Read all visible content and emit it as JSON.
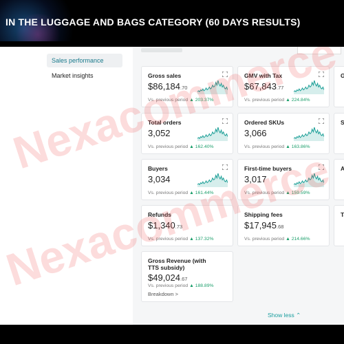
{
  "banner": {
    "title": "IN THE LUGGAGE AND BAGS CATEGORY (60 DAYS RESULTS)"
  },
  "sidebar": {
    "items": [
      {
        "label": "Sales performance",
        "active": true
      },
      {
        "label": "Market insights",
        "active": false
      }
    ]
  },
  "cards": {
    "gross_sales": {
      "title": "Gross sales",
      "value": "$86,184",
      "cents": ".70",
      "vs_label": "Vs. previous period",
      "change": "203.37%"
    },
    "gmv_tax": {
      "title": "GMV with Tax",
      "value": "$67,843",
      "cents": ".77",
      "vs_label": "Vs. previous period",
      "change": "224.84%"
    },
    "total_orders": {
      "title": "Total orders",
      "value": "3,052",
      "vs_label": "Vs. previous period",
      "change": "162.40%"
    },
    "ordered_skus": {
      "title": "Ordered SKUs",
      "value": "3,066",
      "vs_label": "Vs. previous period",
      "change": "163.86%"
    },
    "buyers": {
      "title": "Buyers",
      "value": "3,034",
      "vs_label": "Vs. previous period",
      "change": "161.44%"
    },
    "first_time_buyers": {
      "title": "First-time buyers",
      "value": "3,017",
      "vs_label": "Vs. previous period",
      "change": "159.59%"
    },
    "refunds": {
      "title": "Refunds",
      "value": "$1,340",
      "cents": ".73",
      "vs_label": "Vs. previous period",
      "change": "137.32%"
    },
    "shipping_fees": {
      "title": "Shipping fees",
      "value": "$17,945",
      "cents": ".68",
      "vs_label": "Vs. previous period",
      "change": "214.66%"
    },
    "gross_revenue": {
      "title": "Gross Revenue (with TTS subsidy)",
      "value": "$49,024",
      "cents": ".67",
      "vs_label": "Vs. previous period",
      "change": "188.89%",
      "link": "Breakdown >"
    }
  },
  "partial_cards": [
    "G",
    "Se",
    "A",
    "Ta"
  ],
  "show_less": "Show less ⌃",
  "watermark": [
    "Nexacommerce",
    "Nexacommerce"
  ],
  "colors": {
    "accent": "#1a9e9e",
    "positive": "#1a9e6a",
    "banner_bg": "#000000"
  },
  "icons": {
    "expand": "expand-icon",
    "trend": "trend-up-icon"
  }
}
